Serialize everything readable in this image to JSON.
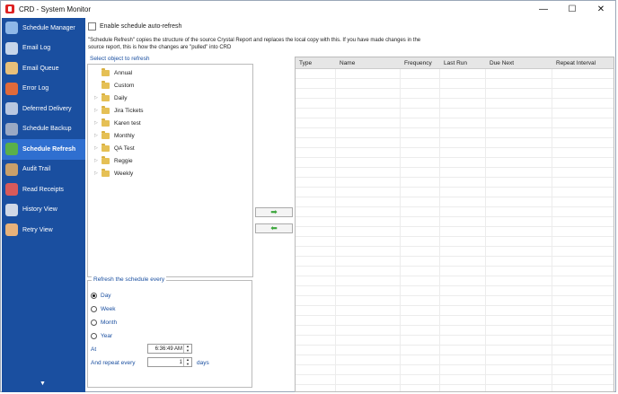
{
  "window": {
    "title": "CRD - System Monitor",
    "controls": [
      "—",
      "☐",
      "✕"
    ]
  },
  "sidebar": {
    "items": [
      {
        "label": "Schedule Manager",
        "icon": "schedule-manager-icon",
        "color": "#8fb8e8",
        "active": false
      },
      {
        "label": "Email Log",
        "icon": "email-log-icon",
        "color": "#c7d6ea",
        "active": false
      },
      {
        "label": "Email Queue",
        "icon": "email-queue-icon",
        "color": "#e8c07a",
        "active": false
      },
      {
        "label": "Error Log",
        "icon": "error-log-icon",
        "color": "#e06a3a",
        "active": false
      },
      {
        "label": "Deferred Delivery",
        "icon": "deferred-delivery-icon",
        "color": "#b9c7e0",
        "active": false
      },
      {
        "label": "Schedule Backup",
        "icon": "schedule-backup-icon",
        "color": "#9aa9c4",
        "active": false
      },
      {
        "label": "Schedule Refresh",
        "icon": "schedule-refresh-icon",
        "color": "#5ab04a",
        "active": true
      },
      {
        "label": "Audit Trail",
        "icon": "audit-trail-icon",
        "color": "#c9a06a",
        "active": false
      },
      {
        "label": "Read Receipts",
        "icon": "read-receipts-icon",
        "color": "#d85a5a",
        "active": false
      },
      {
        "label": "History View",
        "icon": "history-view-icon",
        "color": "#d0d8e6",
        "active": false
      },
      {
        "label": "Retry View",
        "icon": "retry-view-icon",
        "color": "#e8b27a",
        "active": false
      }
    ],
    "scroll_arrow": "▼"
  },
  "main": {
    "auto_refresh_label": "Enable schedule auto-refresh",
    "description": "\"Schedule Refresh\" copies the structure of the source Crystal Report and replaces the local copy with this. If you have made changes in the source report, this is how the changes are \"pulled\" into CRD",
    "tree_label": "Select object to refresh",
    "tree_items": [
      {
        "label": "Annual",
        "expandable": false
      },
      {
        "label": "Custom",
        "expandable": false
      },
      {
        "label": "Daily",
        "expandable": true
      },
      {
        "label": "Jira Tickets",
        "expandable": true
      },
      {
        "label": "Karen test",
        "expandable": true
      },
      {
        "label": "Monthly",
        "expandable": true
      },
      {
        "label": "QA Test",
        "expandable": true
      },
      {
        "label": "Reggie",
        "expandable": true
      },
      {
        "label": "Weekly",
        "expandable": true
      }
    ],
    "refresh_group": {
      "title": "Refresh the schedule every",
      "options": [
        {
          "label": "Day",
          "selected": true
        },
        {
          "label": "Week",
          "selected": false
        },
        {
          "label": "Month",
          "selected": false
        },
        {
          "label": "Year",
          "selected": false
        }
      ],
      "at_label": "At",
      "at_value": "6:36:49 AM",
      "repeat_label": "And repeat every",
      "repeat_value": "1",
      "repeat_unit": "days"
    },
    "add_arrow": "➡",
    "remove_arrow": "⬅",
    "grid_columns": [
      "Type",
      "Name",
      "Frequency",
      "Last Run",
      "Due Next",
      "Repeat Interval"
    ]
  }
}
